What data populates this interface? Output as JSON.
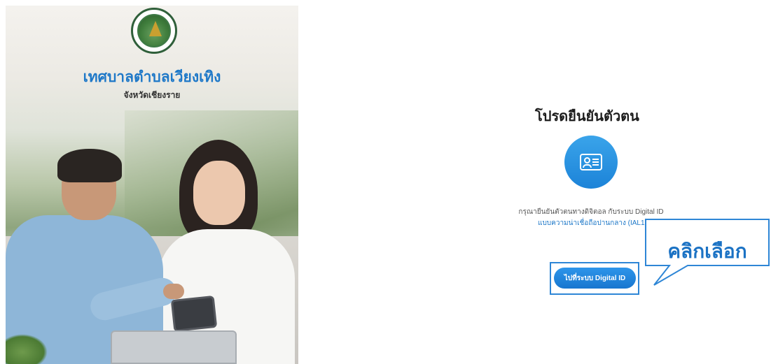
{
  "org": {
    "title": "เทศบาลตำบลเวียงเทิง",
    "subtitle": "จังหวัดเชียงราย"
  },
  "verify": {
    "title": "โปรดยืนยันตัวตน",
    "description_line1": "กรุณายืนยันตัวตนทางดิจิตอล กับระบบ Digital ID",
    "description_line2": "แบบความน่าเชื่อถือปานกลาง (IAL1.3",
    "button_label": "ไปที่ระบบ Digital ID"
  },
  "callout": {
    "text": "คลิกเลือก"
  },
  "colors": {
    "accent": "#1e78c8",
    "button": "#1876cf",
    "highlight": "#2e86d6",
    "callout_text": "#1b72c4"
  },
  "icons": {
    "logo": "municipality-seal-icon",
    "identity": "id-card-icon"
  }
}
